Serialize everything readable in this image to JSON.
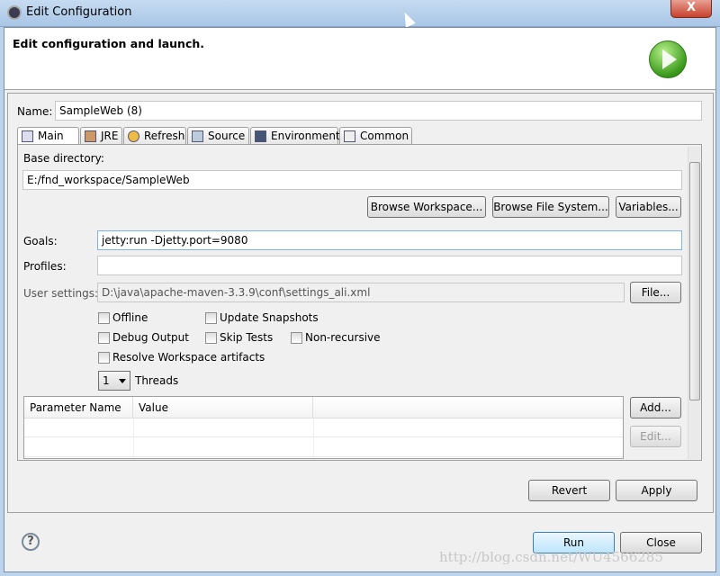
{
  "window": {
    "title": "Edit Configuration",
    "close_label": "X"
  },
  "header": {
    "text": "Edit configuration and launch.",
    "icon": "run-launch-icon"
  },
  "name": {
    "label": "Name:",
    "value": "SampleWeb (8)"
  },
  "tabs": [
    {
      "label": "Main",
      "icon": "main-tab-icon",
      "active": true
    },
    {
      "label": "JRE",
      "icon": "jre-icon"
    },
    {
      "label": "Refresh",
      "icon": "refresh-icon"
    },
    {
      "label": "Source",
      "icon": "source-icon"
    },
    {
      "label": "Environment",
      "icon": "environment-icon"
    },
    {
      "label": "Common",
      "icon": "common-icon"
    }
  ],
  "main": {
    "base_dir_label": "Base directory:",
    "base_dir_value": "E:/fnd_workspace/SampleWeb",
    "browse_workspace": "Browse Workspace...",
    "browse_fs": "Browse File System...",
    "variables": "Variables...",
    "goals_label": "Goals:",
    "goals_value": "jetty:run -Djetty.port=9080",
    "profiles_label": "Profiles:",
    "profiles_value": "",
    "user_settings_label": "User settings:",
    "user_settings_value": "D:\\java\\apache-maven-3.3.9\\conf\\settings_ali.xml",
    "file_button": "File...",
    "checkboxes": {
      "offline": "Offline",
      "update_snapshots": "Update Snapshots",
      "debug_output": "Debug Output",
      "skip_tests": "Skip Tests",
      "non_recursive": "Non-recursive",
      "resolve_workspace": "Resolve Workspace artifacts"
    },
    "threads_value": "1",
    "threads_label": "Threads",
    "table": {
      "columns": [
        "Parameter Name",
        "Value"
      ],
      "rows": []
    },
    "add_button": "Add...",
    "edit_button": "Edit..."
  },
  "footer": {
    "revert": "Revert",
    "apply": "Apply",
    "run": "Run",
    "close": "Close"
  },
  "watermark": "http://blog.csdn.net/WU4566285"
}
